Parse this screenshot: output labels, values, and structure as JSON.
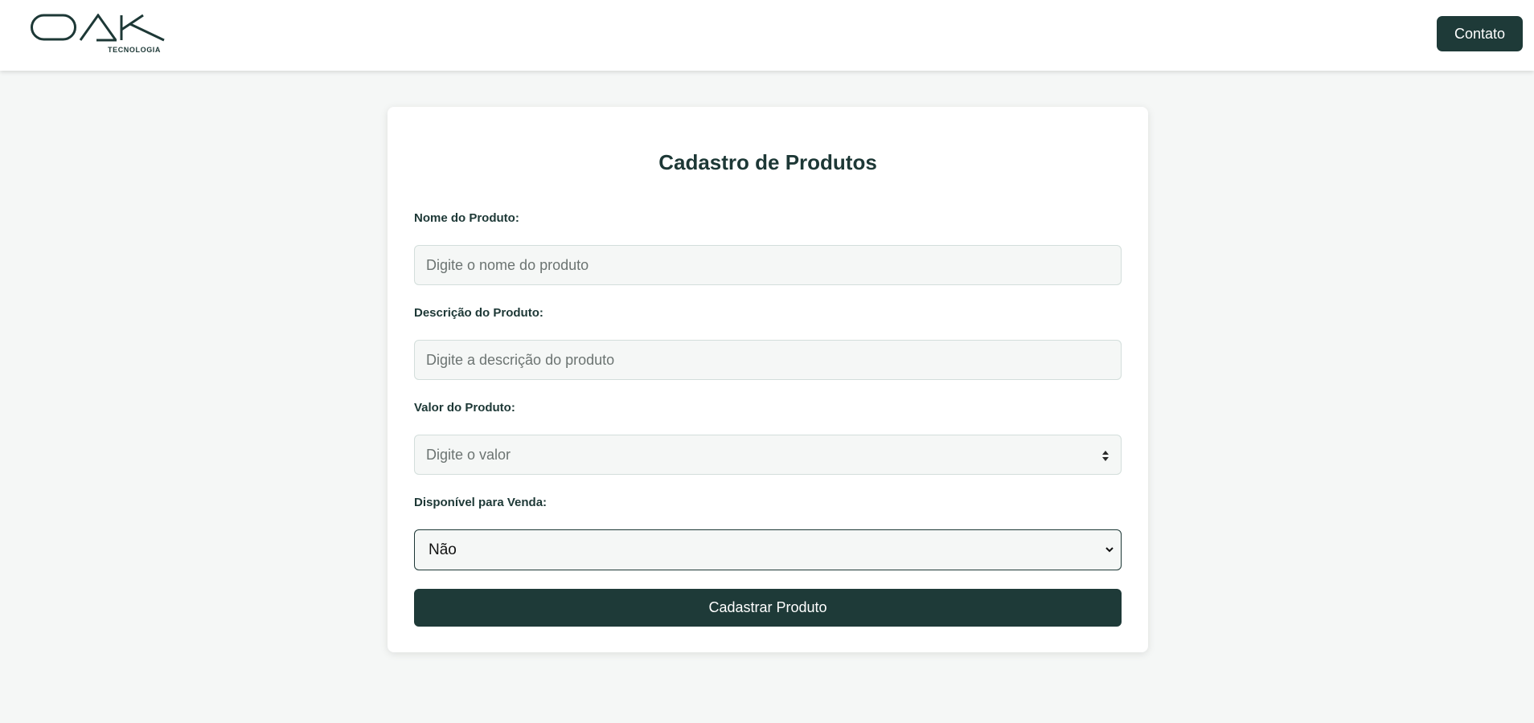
{
  "header": {
    "logo_text": "OAK",
    "logo_subtitle": "TECNOLOGIA",
    "contact_label": "Contato"
  },
  "form": {
    "title": "Cadastro de Produtos",
    "name_label": "Nome do Produto:",
    "name_placeholder": "Digite o nome do produto",
    "description_label": "Descrição do Produto:",
    "description_placeholder": "Digite a descrição do produto",
    "price_label": "Valor do Produto:",
    "price_placeholder": "Digite o valor",
    "available_label": "Disponível para Venda:",
    "available_value": "Não",
    "submit_label": "Cadastrar Produto"
  },
  "colors": {
    "brand": "#1e3a38",
    "page_background": "#f5f7f6",
    "card_background": "#ffffff"
  },
  "icons": {
    "logo": "oak-logo-icon",
    "spinner": "number-spinner-icon",
    "select_arrow": "chevron-down-icon"
  }
}
